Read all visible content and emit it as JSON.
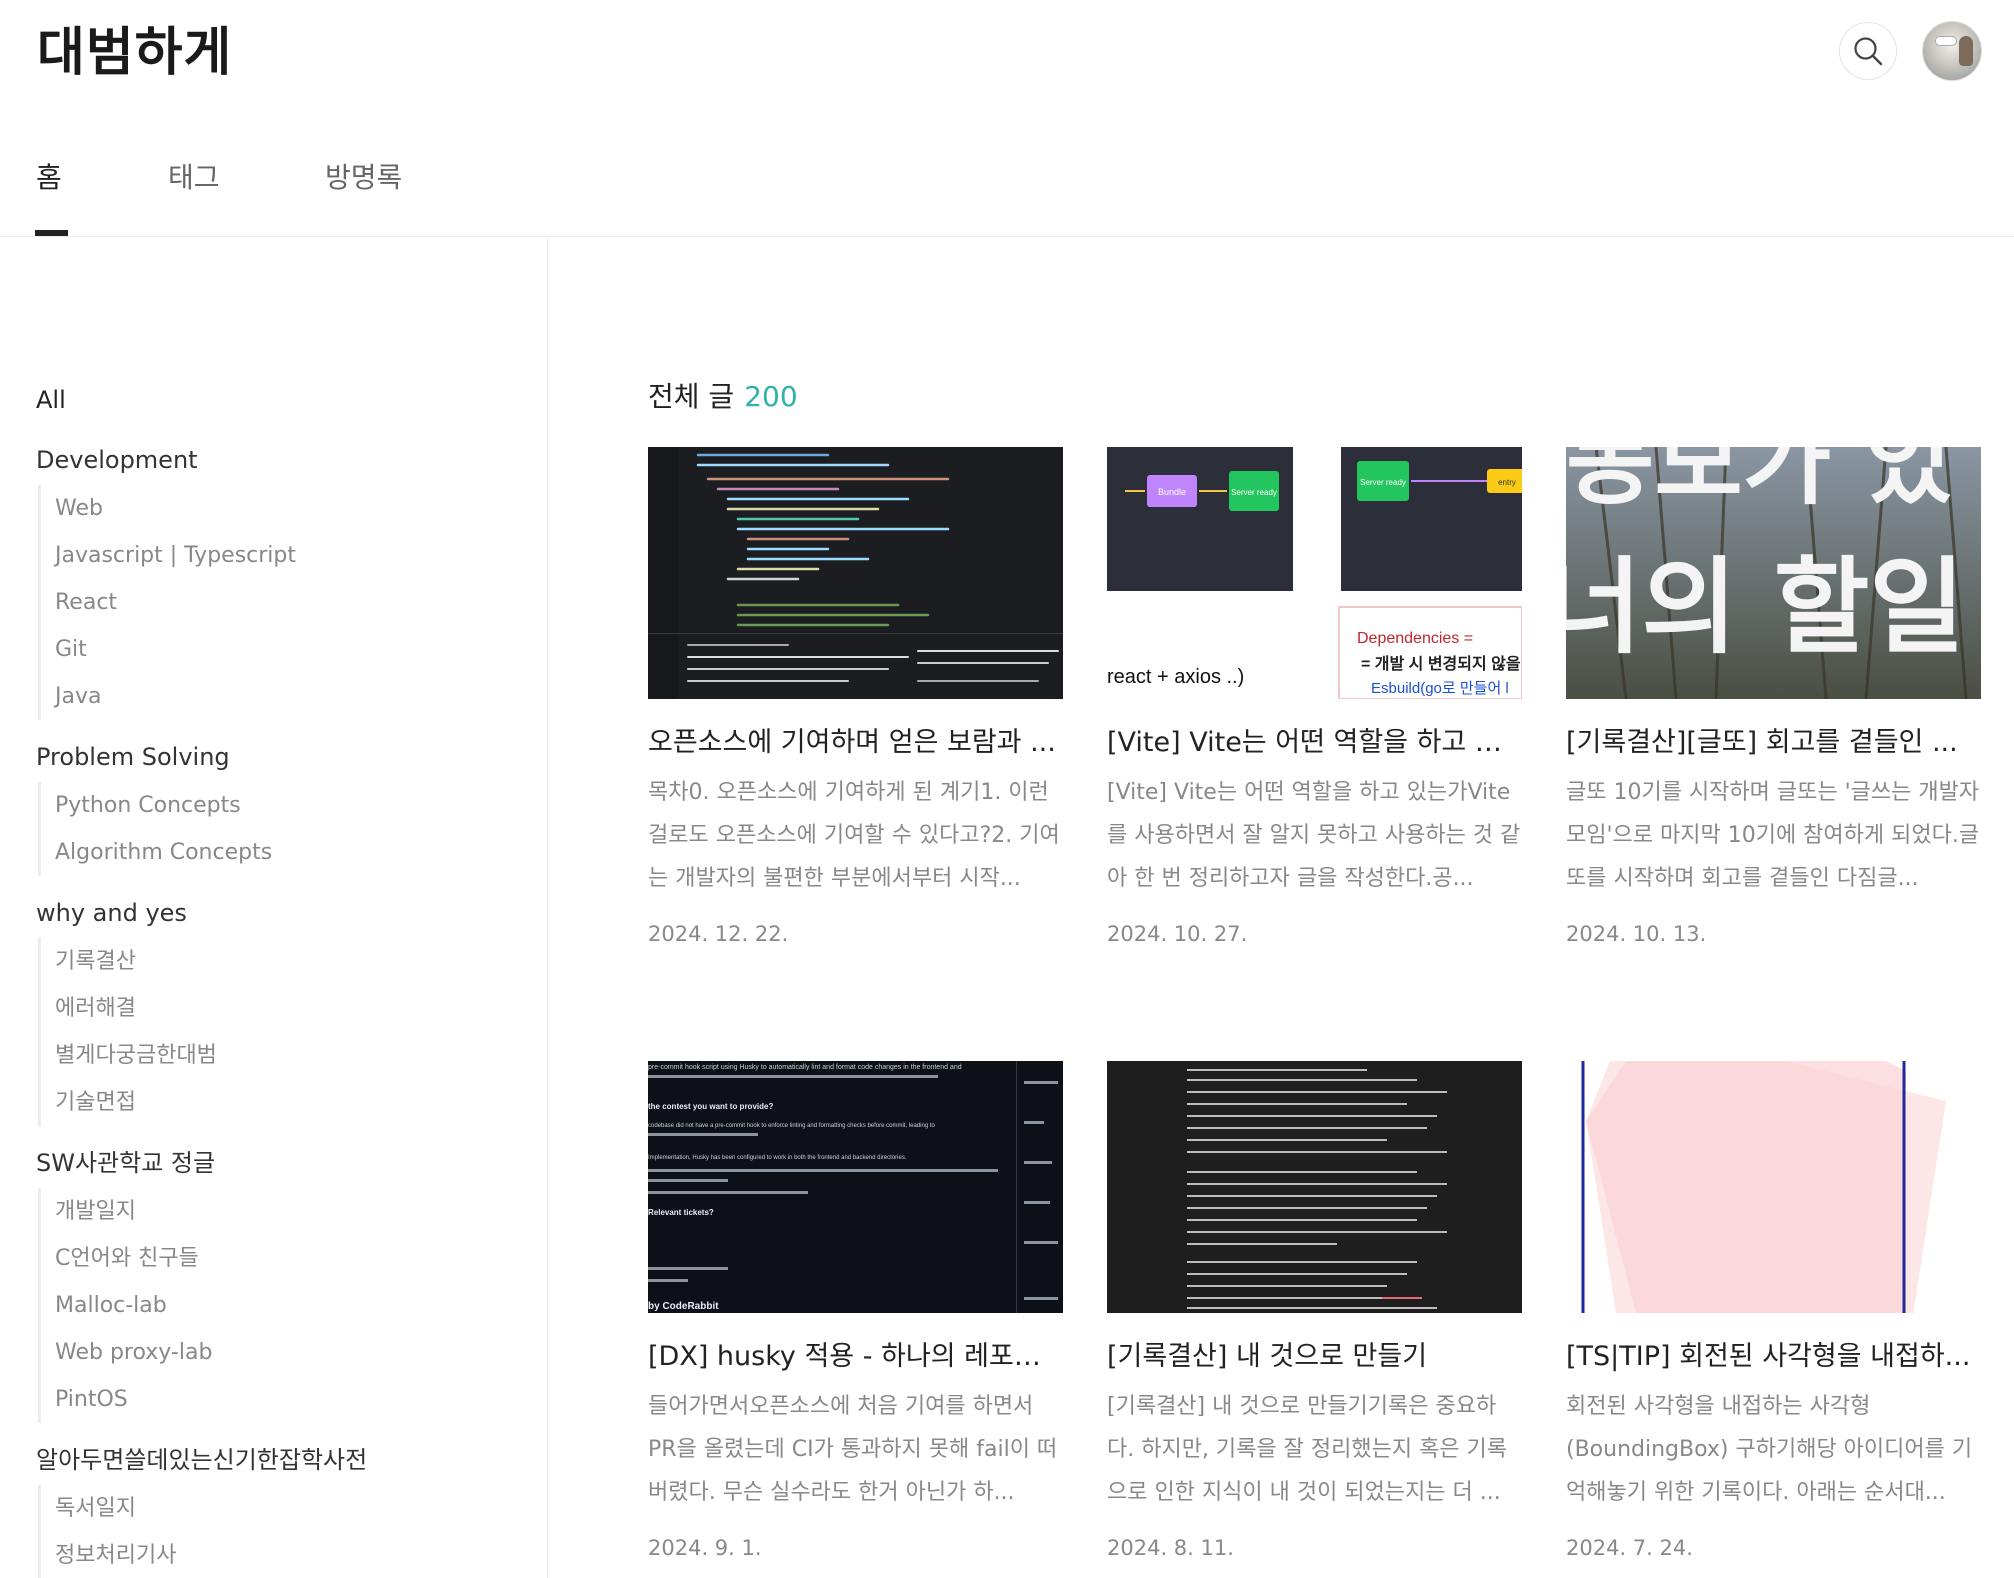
{
  "header": {
    "blog_title": "대범하게"
  },
  "nav": {
    "tabs": [
      {
        "label": "홈"
      },
      {
        "label": "태그"
      },
      {
        "label": "방명록"
      }
    ]
  },
  "sidebar": {
    "all_label": "All",
    "groups": [
      {
        "title": "Development",
        "items": [
          "Web",
          "Javascript | Typescript",
          "React",
          "Git",
          "Java"
        ]
      },
      {
        "title": "Problem Solving",
        "items": [
          "Python Concepts",
          "Algorithm Concepts"
        ]
      },
      {
        "title": "why and yes",
        "items": [
          "기록결산",
          "에러해결",
          "별게다궁금한대범",
          "기술면접"
        ]
      },
      {
        "title": "SW사관학교 정글",
        "items": [
          "개발일지",
          "C언어와 친구들",
          "Malloc-lab",
          "Web proxy-lab",
          "PintOS"
        ]
      },
      {
        "title": "알아두면쓸데있는신기한잡학사전",
        "items": [
          "독서일지",
          "정보처리기사"
        ]
      }
    ]
  },
  "main": {
    "total_label": "전체 글",
    "total_count": "200",
    "posts": [
      {
        "title": "오픈소스에 기여하며 얻은 보람과 ...",
        "summary": "목차0. 오픈소스에 기여하게 된 계기1. 이런 걸로도 오픈소스에 기여할 수 있다고?2. 기여는 개발자의 불편한 부분에서부터 시작...",
        "date": "2024. 12. 22.",
        "thumb_texts": []
      },
      {
        "title": "[Vite] Vite는 어떤 역할을 하고 있...",
        "summary": "[Vite] Vite는 어떤 역할을 하고 있는가Vite를 사용하면서 잘 알지 못하고 사용하는 것 같아 한 번 정리하고자 글을 작성한다.공...",
        "date": "2024. 10. 27.",
        "thumb_texts": [
          "Bundle",
          "Server ready",
          "Server ready",
          "entry",
          "react + axios ..)",
          "Dependencies =",
          "= 개발 시 변경되지 않을",
          "Esbuild(go로 만들어 l"
        ]
      },
      {
        "title": "[기록결산][글또] 회고를 곁들인 ...",
        "summary": "글또 10기를 시작하며 글또는 '글쓰는 개발자 모임'으로 마지막 10기에 참여하게 되었다.글또를 시작하며 회고를 곁들인 다짐글...",
        "date": "2024. 10. 13.",
        "thumb_texts": [
          "동모가 있",
          "너의 할일"
        ]
      },
      {
        "title": "[DX] husky 적용 - 하나의 레포에...",
        "summary": "들어가면서오픈소스에 처음 기여를 하면서 PR을 올렸는데 CI가 통과하지 못해 fail이 떠버렸다. 무슨 실수라도 한거 아닌가 하...",
        "date": "2024. 9. 1.",
        "thumb_texts": [
          "pre-commit hook script using Husky to automatically lint and format code changes in the frontend and",
          "the contest you want to provide?",
          "codebase did not have a pre-commit hook to enforce linting and formatting checks before commit, leading to",
          "Implementation, Husky has been configured to work in both the frontend and backend directories.",
          "Relevant tickets?",
          "by CodeRabbit"
        ]
      },
      {
        "title": "[기록결산] 내 것으로 만들기",
        "summary": "[기록결산] 내 것으로 만들기기록은 중요하다. 하지만, 기록을 잘 정리했는지 혹은 기록으로 인한 지식이 내 것이 되었는지는 더 ...",
        "date": "2024. 8. 11.",
        "thumb_texts": []
      },
      {
        "title": "[TS|TIP] 회전된 사각형을 내접하...",
        "summary": "회전된 사각형을 내접하는 사각형(BoundingBox) 구하기해당 아이디어를 기억해놓기 위한 기록이다. 아래는 순서대...",
        "date": "2024. 7. 24.",
        "thumb_texts": []
      }
    ]
  },
  "colors": {
    "accent": "#2fb3a8",
    "text": "#222222",
    "muted": "#888888",
    "divider": "#ebebeb"
  },
  "icons": {
    "search": "search-icon",
    "avatar": "avatar"
  }
}
